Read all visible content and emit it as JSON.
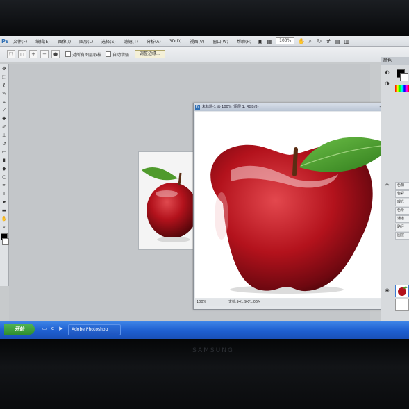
{
  "menubar": {
    "items": [
      "文件(F)",
      "编辑(E)",
      "图像(I)",
      "图层(L)",
      "选择(S)",
      "滤镜(T)",
      "分析(A)",
      "3D(D)",
      "视图(V)",
      "窗口(W)",
      "帮助(H)"
    ],
    "zoom": "100%"
  },
  "optionsbar": {
    "checkbox_label_1": "对所有图层取样",
    "checkbox_label_2": "自动增强",
    "refine_edge": "调整边缘..."
  },
  "doc_large": {
    "title": "未标题-1 @ 100% (图层 1, RGB/8)",
    "zoom": "100%",
    "doc_size": "文档:941.9K/1.06M"
  },
  "panels": {
    "color_header": "颜色",
    "rows": [
      "色相",
      "色彩",
      "曝光",
      "色阶",
      "通道",
      "路径",
      "图层"
    ]
  },
  "taskbar": {
    "start_label": "开始",
    "task_label": "Adobe Photoshop"
  },
  "brand": "SAMSUNG",
  "colors": {
    "taskbar": "#1e5fd0",
    "start": "#2f8f2f",
    "apple_red": "#b3121c",
    "leaf_green": "#4f9a2c",
    "foreground": "#000000",
    "background": "#ffffff"
  },
  "icons": {
    "tools": [
      "move-icon",
      "marquee-icon",
      "lasso-icon",
      "quick-select-icon",
      "crop-icon",
      "eyedropper-icon",
      "healing-icon",
      "brush-icon",
      "stamp-icon",
      "history-brush-icon",
      "eraser-icon",
      "gradient-icon",
      "blur-icon",
      "dodge-icon",
      "pen-icon",
      "type-icon",
      "path-select-icon",
      "shape-icon",
      "hand-icon",
      "zoom-icon"
    ]
  }
}
